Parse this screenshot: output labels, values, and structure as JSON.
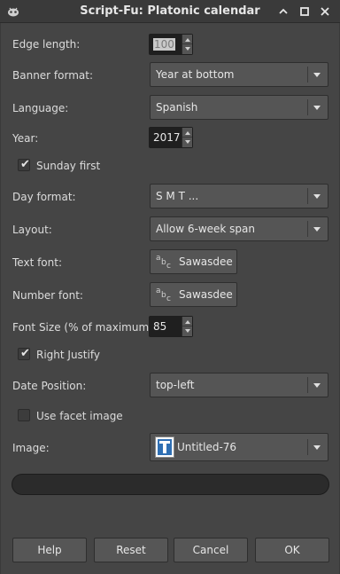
{
  "window": {
    "title": "Script-Fu: Platonic calendar",
    "icon": "gimp-wilber-icon",
    "controls": [
      "minimize-icon",
      "maximize-icon",
      "close-icon"
    ]
  },
  "fields": {
    "edge_length": {
      "label": "Edge length:",
      "value": "100"
    },
    "banner_format": {
      "label": "Banner format:",
      "value": "Year at bottom"
    },
    "language": {
      "label": "Language:",
      "value": "Spanish"
    },
    "year": {
      "label": "Year:",
      "value": "2017"
    },
    "sunday_first": {
      "label": "Sunday first",
      "checked": true
    },
    "day_format": {
      "label": "Day format:",
      "value": "S M T ..."
    },
    "layout": {
      "label": "Layout:",
      "value": "Allow 6-week span"
    },
    "text_font": {
      "label": "Text font:",
      "value": "Sawasdee"
    },
    "number_font": {
      "label": "Number font:",
      "value": "Sawasdee"
    },
    "font_size": {
      "label": "Font Size (% of maximum):",
      "value": "85"
    },
    "right_justify": {
      "label": "Right Justify",
      "checked": true
    },
    "date_position": {
      "label": "Date Position:",
      "value": "top-left"
    },
    "use_facet_image": {
      "label": "Use facet image",
      "checked": false
    },
    "image": {
      "label": "Image:",
      "value": "Untitled-76"
    }
  },
  "font_preview": {
    "a": "a",
    "b": "b",
    "c": "c"
  },
  "buttons": {
    "help": "Help",
    "reset": "Reset",
    "cancel": "Cancel",
    "ok": "OK"
  }
}
